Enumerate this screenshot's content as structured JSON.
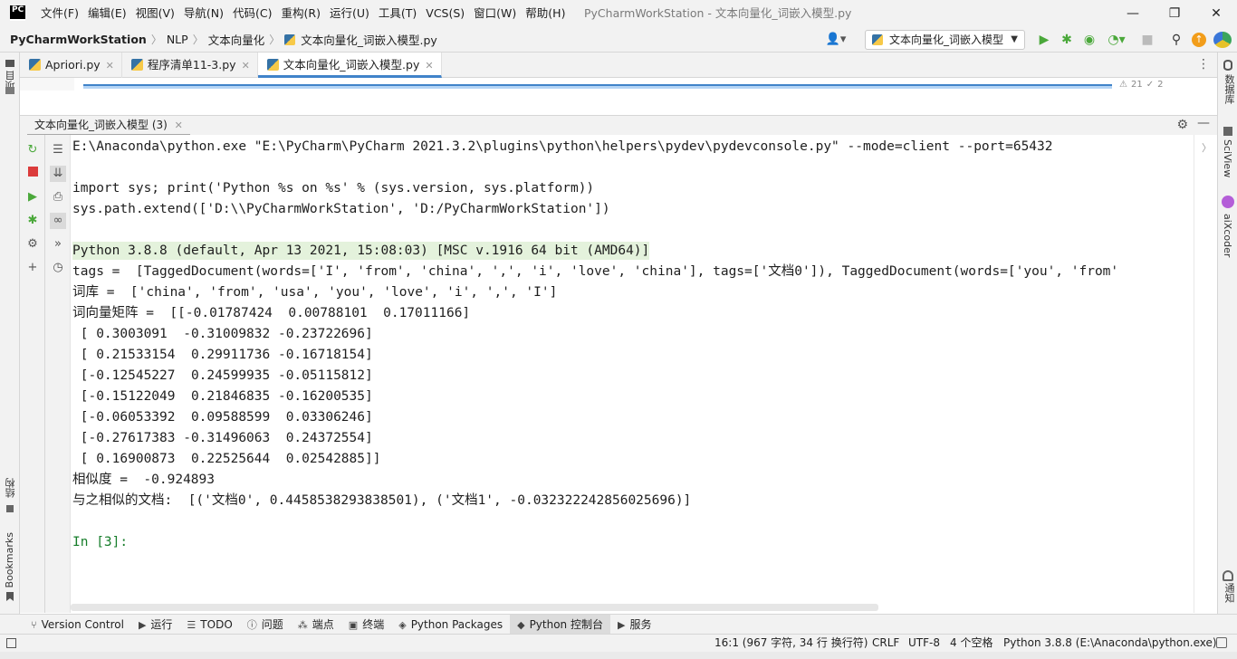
{
  "window": {
    "title": "PyCharmWorkStation - 文本向量化_词嵌入模型.py",
    "logo_text": "PC",
    "controls": {
      "minimize": "—",
      "maximize": "❐",
      "close": "✕"
    }
  },
  "menu": [
    "文件(F)",
    "编辑(E)",
    "视图(V)",
    "导航(N)",
    "代码(C)",
    "重构(R)",
    "运行(U)",
    "工具(T)",
    "VCS(S)",
    "窗口(W)",
    "帮助(H)"
  ],
  "breadcrumb": [
    "PyCharmWorkStation",
    "NLP",
    "文本向量化",
    "文本向量化_词嵌入模型.py"
  ],
  "run_config": {
    "label": "文本向量化_词嵌入模型"
  },
  "left_strip": {
    "top": "项目",
    "middle": "结构",
    "bottom": "Bookmarks"
  },
  "right_strip": {
    "top": "数据库",
    "middle": "SciView",
    "bottom": "aiXcoder",
    "last": "通知"
  },
  "tabs": [
    {
      "label": "Apriori.py",
      "active": false
    },
    {
      "label": "程序清单11-3.py",
      "active": false
    },
    {
      "label": "文本向量化_词嵌入模型.py",
      "active": true
    }
  ],
  "editor_indicator": {
    "warnings": "21",
    "weak": "2"
  },
  "panel": {
    "tab_label": "文本向量化_词嵌入模型 (3)"
  },
  "console": {
    "lines": [
      "E:\\Anaconda\\python.exe \"E:\\PyCharm\\PyCharm 2021.3.2\\plugins\\python\\helpers\\pydev\\pydevconsole.py\" --mode=client --port=65432",
      "",
      "import sys; print('Python %s on %s' % (sys.version, sys.platform))",
      "sys.path.extend(['D:\\\\PyCharmWorkStation', 'D:/PyCharmWorkStation'])",
      "",
      "Python 3.8.8 (default, Apr 13 2021, 15:08:03) [MSC v.1916 64 bit (AMD64)]",
      "tags =  [TaggedDocument(words=['I', 'from', 'china', ',', 'i', 'love', 'china'], tags=['文档0']), TaggedDocument(words=['you', 'from'",
      "词库 =  ['china', 'from', 'usa', 'you', 'love', 'i', ',', 'I']",
      "词向量矩阵 =  [[-0.01787424  0.00788101  0.17011166]",
      " [ 0.3003091  -0.31009832 -0.23722696]",
      " [ 0.21533154  0.29911736 -0.16718154]",
      " [-0.12545227  0.24599935 -0.05115812]",
      " [-0.15122049  0.21846835 -0.16200535]",
      " [-0.06053392  0.09588599  0.03306246]",
      " [-0.27617383 -0.31496063  0.24372554]",
      " [ 0.16900873  0.22525644  0.02542885]]",
      "相似度 =  -0.924893",
      "与之相似的文档:  [('文档0', 0.4458538293838501), ('文档1', -0.032322242856025696)]",
      "",
      "In [3]:"
    ]
  },
  "tool_windows": [
    {
      "label": "Version Control",
      "icon": "branch-icon",
      "active": false
    },
    {
      "label": "运行",
      "icon": "run-icon",
      "active": false
    },
    {
      "label": "TODO",
      "icon": "list-icon",
      "active": false
    },
    {
      "label": "问题",
      "icon": "info-icon",
      "active": false
    },
    {
      "label": "端点",
      "icon": "endpoint-icon",
      "active": false
    },
    {
      "label": "终端",
      "icon": "terminal-icon",
      "active": false
    },
    {
      "label": "Python Packages",
      "icon": "packages-icon",
      "active": false
    },
    {
      "label": "Python 控制台",
      "icon": "python-icon",
      "active": true
    },
    {
      "label": "服务",
      "icon": "services-icon",
      "active": false
    }
  ],
  "status": {
    "position": "16:1 (967 字符, 34 行 换行符)",
    "line_sep": "CRLF",
    "encoding": "UTF-8",
    "indent": "4 个空格",
    "interpreter": "Python 3.8.8 (E:\\Anaconda\\python.exe)"
  },
  "colors": {
    "accent": "#4083c9",
    "run_green": "#4aa83a",
    "stop_red": "#db3b3b",
    "console_green": "#167d2a"
  }
}
